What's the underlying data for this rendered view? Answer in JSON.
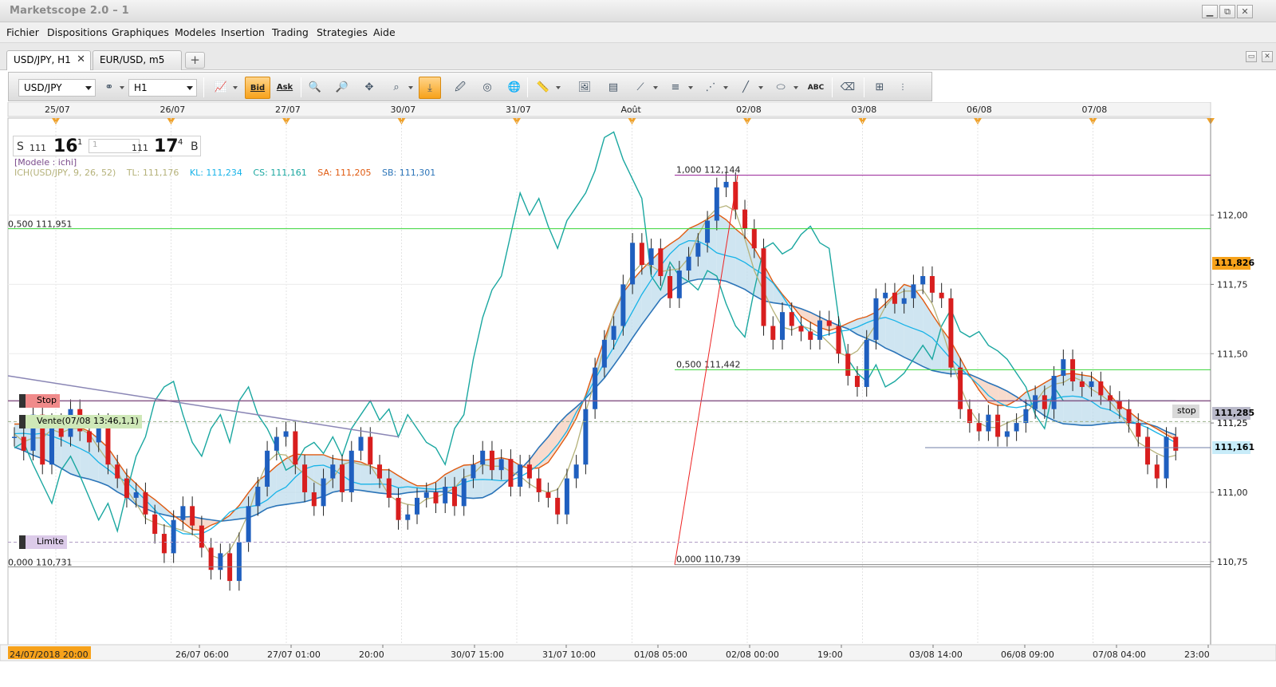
{
  "window": {
    "title": "Marketscope 2.0 – 1",
    "min": "▁",
    "max": "⧉",
    "close": "✕"
  },
  "menu": [
    "Fichier",
    "Dispositions",
    "Graphiques",
    "Modeles",
    "Insertion",
    "Trading",
    "Strategies",
    "Aide"
  ],
  "tabs": [
    {
      "label": "USD/JPY, H1",
      "active": true,
      "close": "✕"
    },
    {
      "label": "EUR/USD, m5",
      "active": false
    }
  ],
  "tab_add": "+",
  "toolbar": {
    "instrument": "USD/JPY",
    "timeframe": "H1",
    "bid_label": "Bid",
    "ask_label": "Ask",
    "abc_label": "ABC"
  },
  "quote": {
    "sell_label": "S",
    "sell_prefix": "111",
    "sell_big": "16",
    "sell_pip": "1",
    "qty": "1",
    "buy_prefix": "111",
    "buy_big": "17",
    "buy_pip": "4",
    "buy_label": "B"
  },
  "model_label": "[Modele : ichi]",
  "indicator_legend": [
    {
      "text": "ICH(USD/JPY, 9, 26, 52)",
      "color": "#b5b27a"
    },
    {
      "text": "TL: 111,176",
      "color": "#b5b27a"
    },
    {
      "text": "KL: 111,234",
      "color": "#17b3e8"
    },
    {
      "text": "CS: 111,161",
      "color": "#1aa7a0"
    },
    {
      "text": "SA: 111,205",
      "color": "#e05a10"
    },
    {
      "text": "SB: 111,301",
      "color": "#2b74b8"
    }
  ],
  "chart_data": {
    "type": "candlestick",
    "instrument": "USD/JPY",
    "timeframe": "H1",
    "ylim": [
      110.45,
      112.35
    ],
    "y_ticks": [
      "112,00",
      "111,75",
      "111,50",
      "111,25",
      "111,00",
      "110,75"
    ],
    "y_tick_values": [
      112.0,
      111.75,
      111.5,
      111.25,
      111.0,
      110.75
    ],
    "top_dates": [
      "25/07",
      "26/07",
      "27/07",
      "30/07",
      "31/07",
      "Août",
      "02/08",
      "03/08",
      "06/08",
      "07/08"
    ],
    "bottom_times": [
      "26/07 06:00",
      "27/07 01:00",
      "20:00",
      "30/07 15:00",
      "31/07 10:00",
      "01/08 05:00",
      "02/08 00:00",
      "19:00",
      "03/08 14:00",
      "06/08 09:00",
      "07/08 04:00",
      "23:00"
    ],
    "start_time_label": "24/07/2018 20:00",
    "price_markers": [
      {
        "value": "111,826",
        "level": 111.826,
        "bg": "#f7a21b",
        "fg": "#000000"
      },
      {
        "value": "111,285",
        "level": 111.285,
        "bg": "#b9b9c9",
        "fg": "#000000"
      },
      {
        "value": "111,161",
        "level": 111.161,
        "bg": "#c8ecf9",
        "fg": "#000000"
      }
    ],
    "fib_left": {
      "labels": [
        "0,500 111,951",
        "0,000 110,731"
      ],
      "levels": [
        111.951,
        110.731
      ]
    },
    "fib_right": {
      "labels": [
        "1,000 112,144",
        "0,500 111,442",
        "0,000 110,739"
      ],
      "levels": [
        112.144,
        111.442,
        110.739
      ]
    },
    "orders": [
      {
        "label": "Stop",
        "level": 111.33,
        "bg": "#f08a8a"
      },
      {
        "label": "Vente(07/08 13:46,1,1)",
        "level": 111.255,
        "bg": "#cfe8b8"
      },
      {
        "label": "Limite",
        "level": 110.82,
        "bg": "#dccbe9"
      }
    ],
    "stop_tag": "stop",
    "close_series": [
      111.2,
      111.15,
      111.28,
      111.1,
      111.25,
      111.2,
      111.3,
      111.22,
      111.18,
      111.25,
      111.1,
      111.05,
      110.98,
      111.0,
      110.92,
      110.85,
      110.78,
      110.9,
      110.95,
      110.88,
      110.8,
      110.72,
      110.78,
      110.68,
      110.82,
      110.95,
      111.02,
      111.15,
      111.2,
      111.22,
      111.1,
      111.0,
      110.95,
      111.05,
      111.1,
      111.0,
      111.15,
      111.2,
      111.1,
      111.05,
      110.98,
      110.9,
      110.92,
      110.98,
      111.0,
      110.96,
      111.02,
      110.95,
      111.05,
      111.1,
      111.15,
      111.08,
      111.12,
      111.02,
      111.1,
      111.05,
      111.0,
      110.98,
      110.92,
      111.05,
      111.1,
      111.3,
      111.45,
      111.55,
      111.6,
      111.75,
      111.9,
      111.82,
      111.88,
      111.78,
      111.7,
      111.8,
      111.85,
      111.9,
      111.98,
      112.1,
      112.12,
      112.02,
      111.95,
      111.88,
      111.6,
      111.55,
      111.65,
      111.6,
      111.58,
      111.55,
      111.62,
      111.6,
      111.5,
      111.42,
      111.38,
      111.55,
      111.7,
      111.72,
      111.68,
      111.7,
      111.75,
      111.78,
      111.72,
      111.7,
      111.45,
      111.3,
      111.25,
      111.22,
      111.28,
      111.2,
      111.22,
      111.25,
      111.3,
      111.35,
      111.3,
      111.42,
      111.48,
      111.4,
      111.38,
      111.4,
      111.35,
      111.33,
      111.3,
      111.25,
      111.2,
      111.1,
      111.05,
      111.2,
      111.15
    ],
    "title": "",
    "xlabel": "",
    "ylabel": "",
    "grid": true
  }
}
